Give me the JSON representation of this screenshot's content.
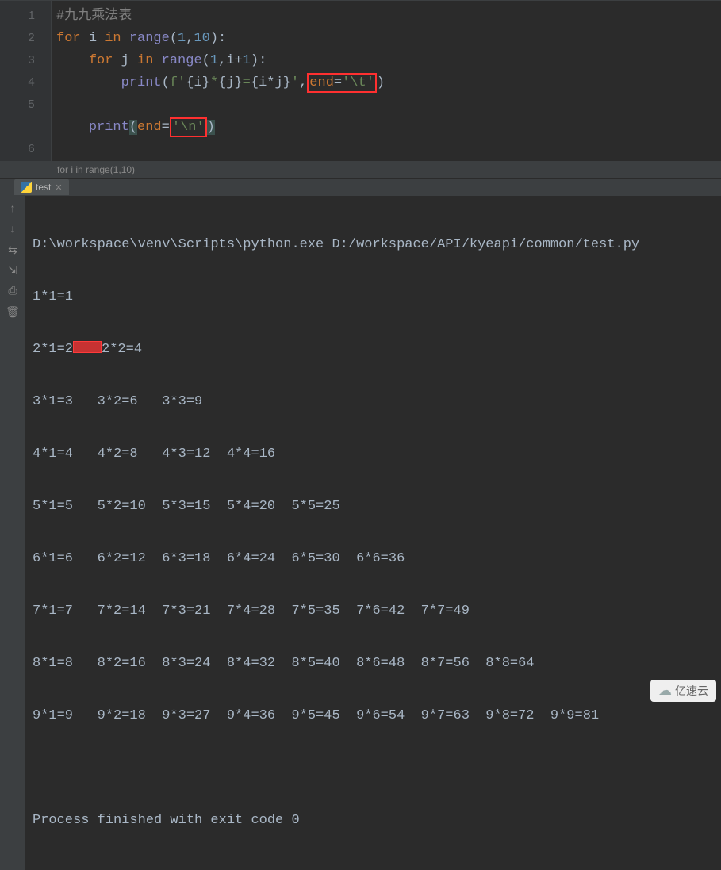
{
  "editor": {
    "line_numbers": [
      "1",
      "2",
      "3",
      "4",
      "5",
      "",
      "6"
    ],
    "code": {
      "l1": {
        "comment": "#九九乘法表"
      },
      "l2": {
        "kw1": "for",
        "i": "i",
        "kw2": "in",
        "fn": "range",
        "op": "(",
        "n1": "1",
        "comma": ",",
        "n2": "10",
        "cp": "):"
      },
      "l3": {
        "kw1": "for",
        "j": "j",
        "kw2": "in",
        "fn": "range",
        "op": "(",
        "n1": "1",
        "comma": ",",
        "i": "i",
        "plus": "+",
        "one": "1",
        "cp": "):"
      },
      "l4": {
        "fn": "print",
        "op": "(",
        "fpre": "f'",
        "ob1": "{",
        "i": "i",
        "cb1": "}",
        "star": "*",
        "ob2": "{",
        "j": "j",
        "cb2": "}",
        "eq": "=",
        "ob3": "{",
        "i2": "i",
        "star2": "*",
        "j2": "j",
        "cb3": "}",
        "fend": "'",
        "comma": ",",
        "end_kw": "end",
        "assign": "=",
        "t_str": "'\\t'",
        "cp": ")"
      },
      "l6": {
        "fn": "print",
        "op": "(",
        "end_kw": "end",
        "assign": "=",
        "n_str": "'\\n'",
        "cp": ")"
      }
    }
  },
  "breadcrumb": "for i in range(1,10)",
  "run_tab": {
    "label": "test"
  },
  "console": {
    "cmd": "D:\\workspace\\venv\\Scripts\\python.exe D:/workspace/API/kyeapi/common/test.py",
    "rows": [
      "1*1=1",
      "2*1=2\u00002*2=4",
      "3*1=3   3*2=6   3*3=9",
      "4*1=4   4*2=8   4*3=12  4*4=16",
      "5*1=5   5*2=10  5*3=15  5*4=20  5*5=25",
      "6*1=6   6*2=12  6*3=18  6*4=24  6*5=30  6*6=36",
      "7*1=7   7*2=14  7*3=21  7*4=28  7*5=35  7*6=42  7*7=49",
      "8*1=8   8*2=16  8*3=24  8*4=32  8*5=40  8*6=48  8*7=56  8*8=64",
      "9*1=9   9*2=18  9*3=27  9*4=36  9*5=45  9*6=54  9*7=63  9*8=72  9*9=81"
    ],
    "exit": "Process finished with exit code 0"
  },
  "watermark": "亿速云"
}
